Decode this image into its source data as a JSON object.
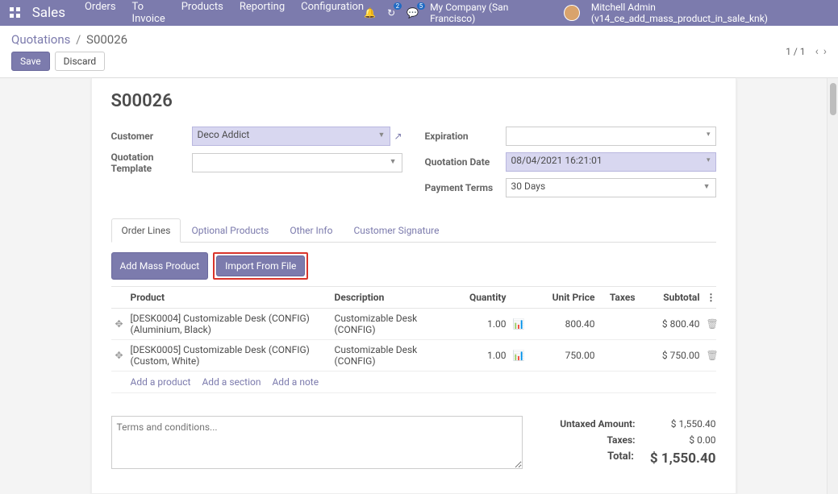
{
  "topbar": {
    "app_title": "Sales",
    "menu": [
      "Orders",
      "To Invoice",
      "Products",
      "Reporting",
      "Configuration"
    ],
    "badge_refresh": "2",
    "badge_msg": "5",
    "company": "My Company (San Francisco)",
    "user": "Mitchell Admin (v14_ce_add_mass_product_in_sale_knk)"
  },
  "breadcrumb": {
    "root": "Quotations",
    "current": "S00026"
  },
  "actions": {
    "save": "Save",
    "discard": "Discard",
    "pager": "1 / 1"
  },
  "doc": {
    "title": "S00026",
    "labels": {
      "customer": "Customer",
      "quotation_template": "Quotation Template",
      "expiration": "Expiration",
      "quotation_date": "Quotation Date",
      "payment_terms": "Payment Terms"
    },
    "values": {
      "customer": "Deco Addict",
      "quotation_template": "",
      "expiration": "",
      "quotation_date": "08/04/2021 16:21:01",
      "payment_terms": "30 Days"
    }
  },
  "tabs": [
    "Order Lines",
    "Optional Products",
    "Other Info",
    "Customer Signature"
  ],
  "table_actions": {
    "add_mass": "Add Mass Product",
    "import_file": "Import From File"
  },
  "columns": {
    "product": "Product",
    "description": "Description",
    "quantity": "Quantity",
    "unit_price": "Unit Price",
    "taxes": "Taxes",
    "subtotal": "Subtotal"
  },
  "rows": [
    {
      "product": "[DESK0004] Customizable Desk (CONFIG) (Aluminium, Black)",
      "description": "Customizable Desk (CONFIG)",
      "quantity": "1.00",
      "unit_price": "800.40",
      "taxes": "",
      "subtotal": "$ 800.40"
    },
    {
      "product": "[DESK0005] Customizable Desk (CONFIG) (Custom, White)",
      "description": "Customizable Desk (CONFIG)",
      "quantity": "1.00",
      "unit_price": "750.00",
      "taxes": "",
      "subtotal": "$ 750.00"
    }
  ],
  "add_links": {
    "product": "Add a product",
    "section": "Add a section",
    "note": "Add a note"
  },
  "terms_placeholder": "Terms and conditions...",
  "totals": {
    "untaxed_label": "Untaxed Amount:",
    "untaxed_val": "$ 1,550.40",
    "taxes_label": "Taxes:",
    "taxes_val": "$ 0.00",
    "total_label": "Total:",
    "total_val": "$ 1,550.40"
  }
}
